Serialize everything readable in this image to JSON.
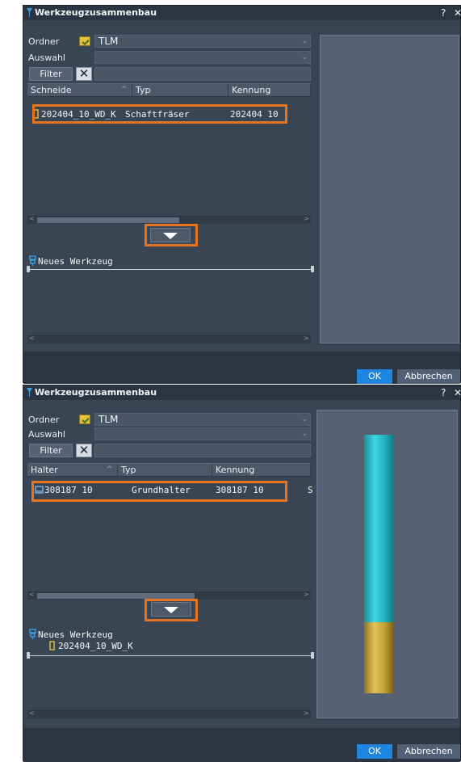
{
  "dialog1": {
    "title": "Werkzeugzusammenbau",
    "help_label": "?",
    "close_label": "✕",
    "folder_label": "Ordner",
    "folder_value": "TLM",
    "selection_label": "Auswahl",
    "selection_value": "",
    "filter_button": "Filter",
    "clear_filter_button": "✕",
    "filter_value": "",
    "columns": [
      "Schneide",
      "Typ",
      "Kennung"
    ],
    "row": {
      "name": "202404_10_WD_K",
      "type": "Schaftfräser",
      "id": "202404 10"
    },
    "tree_root": "Neues Werkzeug",
    "ok_button": "OK",
    "cancel_button": "Abbrechen"
  },
  "dialog2": {
    "title": "Werkzeugzusammenbau",
    "help_label": "?",
    "close_label": "✕",
    "folder_label": "Ordner",
    "folder_value": "TLM",
    "selection_label": "Auswahl",
    "selection_value": "",
    "filter_button": "Filter",
    "clear_filter_button": "✕",
    "filter_value": "",
    "columns": [
      "Halter",
      "Typ",
      "Kennung"
    ],
    "row": {
      "name": "308187 10",
      "type": "Grundhalter",
      "id": "308187 10",
      "extra": "S"
    },
    "tree_root": "Neues Werkzeug",
    "tree_child": "202404_10_WD_K",
    "ok_button": "OK",
    "cancel_button": "Abbrechen"
  },
  "colors": {
    "highlight": "#e8731e",
    "ok_blue": "#1f86e0",
    "shank": "#2ab8c8",
    "cutter": "#c9a93a"
  },
  "icons": [
    "werkzeug-icon",
    "folder-icon",
    "insert-icon",
    "holder-icon",
    "tool-tree-icon",
    "down-arrow-icon"
  ]
}
